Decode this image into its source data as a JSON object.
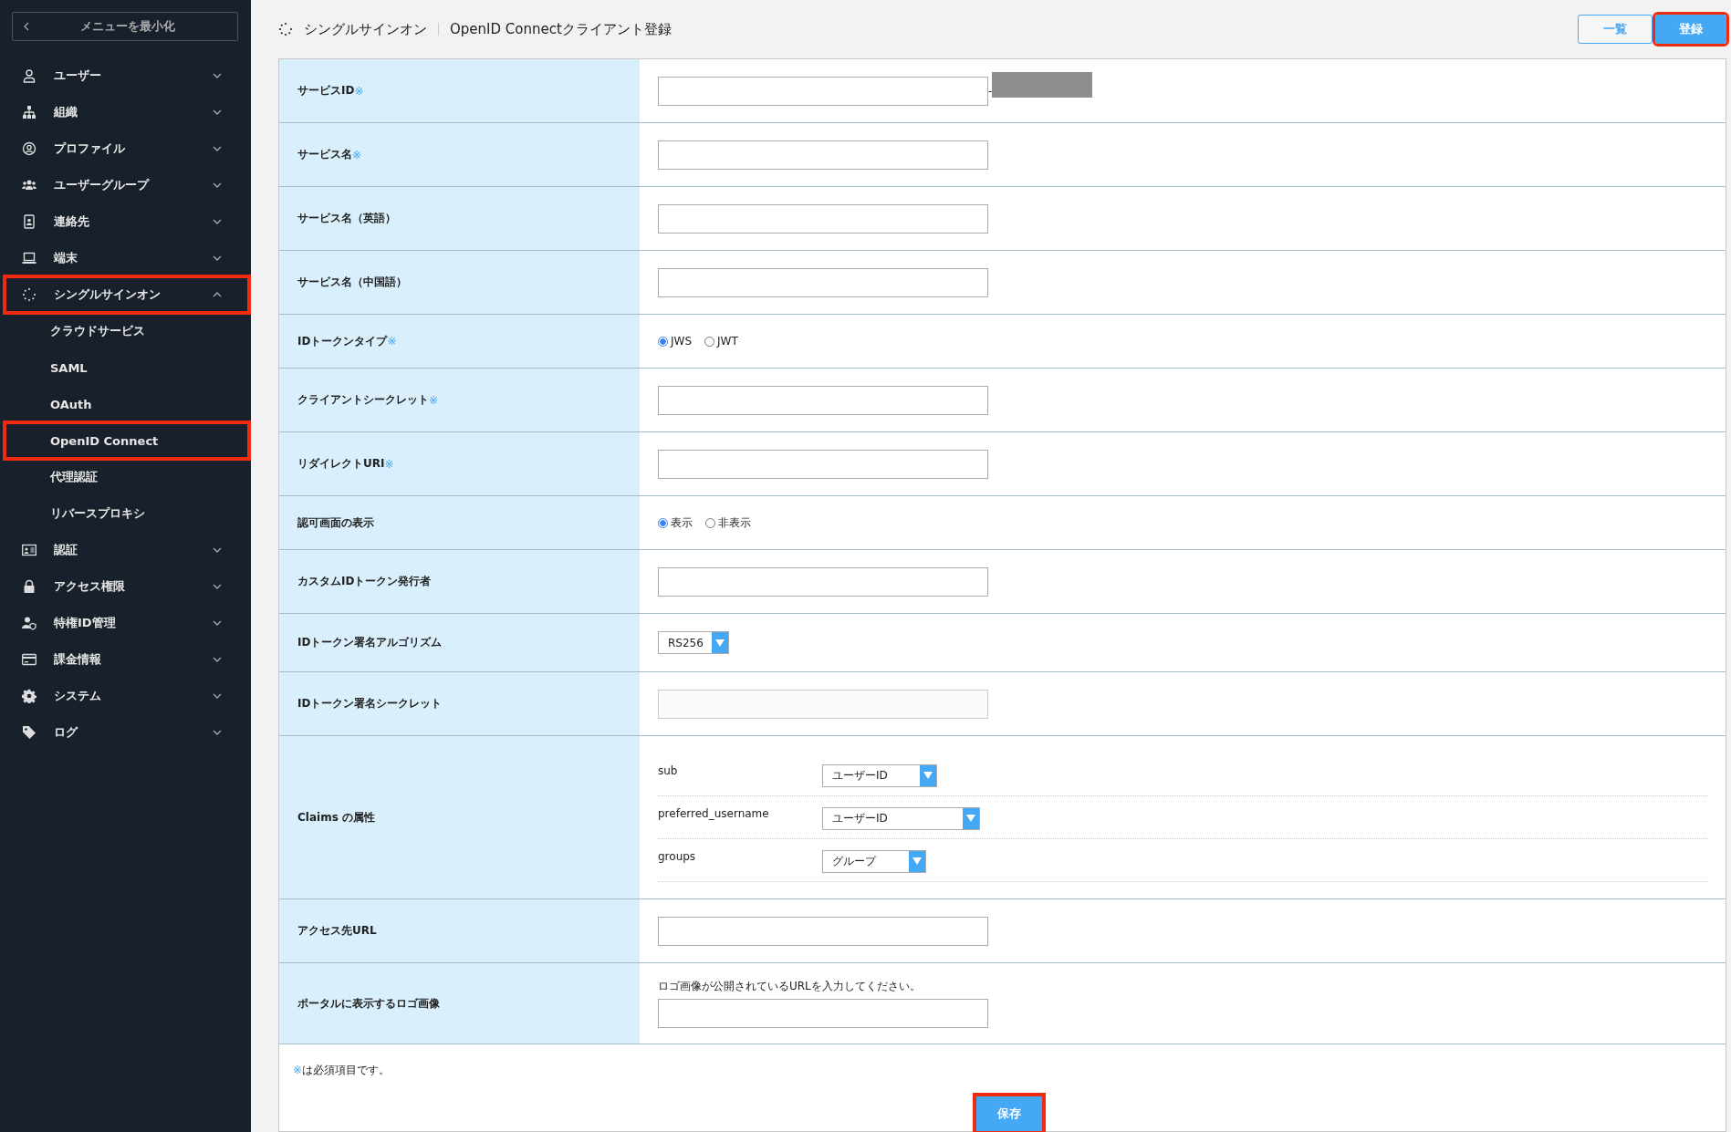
{
  "sidebar": {
    "collapse_button": "メニューを最小化",
    "items": [
      {
        "label": "ユーザー",
        "expanded": false,
        "highlighted": false
      },
      {
        "label": "組織",
        "expanded": false,
        "highlighted": false
      },
      {
        "label": "プロファイル",
        "expanded": false,
        "highlighted": false
      },
      {
        "label": "ユーザーグループ",
        "expanded": false,
        "highlighted": false
      },
      {
        "label": "連絡先",
        "expanded": false,
        "highlighted": false
      },
      {
        "label": "端末",
        "expanded": false,
        "highlighted": false
      },
      {
        "label": "シングルサインオン",
        "expanded": true,
        "highlighted": true,
        "children": [
          {
            "label": "クラウドサービス",
            "highlighted": false
          },
          {
            "label": "SAML",
            "highlighted": false
          },
          {
            "label": "OAuth",
            "highlighted": false
          },
          {
            "label": "OpenID Connect",
            "highlighted": true
          },
          {
            "label": "代理認証",
            "highlighted": false
          },
          {
            "label": "リバースプロキシ",
            "highlighted": false
          }
        ]
      },
      {
        "label": "認証",
        "expanded": false,
        "highlighted": false
      },
      {
        "label": "アクセス権限",
        "expanded": false,
        "highlighted": false
      },
      {
        "label": "特権ID管理",
        "expanded": false,
        "highlighted": false
      },
      {
        "label": "課金情報",
        "expanded": false,
        "highlighted": false
      },
      {
        "label": "システム",
        "expanded": false,
        "highlighted": false
      },
      {
        "label": "ログ",
        "expanded": false,
        "highlighted": false
      }
    ]
  },
  "header": {
    "breadcrumb": [
      "シングルサインオン",
      "OpenID Connectクライアント登録"
    ],
    "buttons": [
      {
        "label": "一覧",
        "kind": "outline",
        "highlighted": false
      },
      {
        "label": "登録",
        "kind": "primary",
        "highlighted": true
      }
    ]
  },
  "form": {
    "rows": [
      {
        "label": "サービスID",
        "mark": "※",
        "kind": "text",
        "separator": "-"
      },
      {
        "label": "サービス名",
        "mark": "※",
        "kind": "text"
      },
      {
        "label": "サービス名（英語）",
        "kind": "text"
      },
      {
        "label": "サービス名（中国語）",
        "kind": "text"
      },
      {
        "label": "IDトークンタイプ",
        "mark": "※",
        "kind": "radio",
        "options": [
          {
            "label": "JWS",
            "selected": true
          },
          {
            "label": "JWT",
            "selected": false
          }
        ]
      },
      {
        "label": "クライアントシークレット",
        "mark": "※",
        "kind": "text"
      },
      {
        "label": "リダイレクトURI",
        "mark": "※",
        "kind": "text"
      },
      {
        "label": "認可画面の表示",
        "kind": "radio",
        "options": [
          {
            "label": "表示",
            "selected": true
          },
          {
            "label": "非表示",
            "selected": false
          }
        ]
      },
      {
        "label": "カスタムIDトークン発行者",
        "kind": "text"
      },
      {
        "label": "IDトークン署名アルゴリズム",
        "kind": "select",
        "value": "RS256"
      },
      {
        "label": "IDトークン署名シークレット",
        "kind": "text",
        "disabled": true
      },
      {
        "label": "Claims の属性",
        "kind": "claims",
        "claims": [
          {
            "name": "sub",
            "value": "ユーザーID"
          },
          {
            "name": "preferred_username",
            "value": "ユーザーID"
          },
          {
            "name": "groups",
            "value": "グループ"
          }
        ]
      },
      {
        "label": "アクセス先URL",
        "kind": "text"
      },
      {
        "label": "ポータルに表示するロゴ画像",
        "kind": "text",
        "hint": "ロゴ画像が公開されているURLを入力してください。"
      }
    ],
    "note_mark": "※",
    "note": "は必須項目です。",
    "save_button": {
      "label": "保存",
      "highlighted": true
    }
  }
}
